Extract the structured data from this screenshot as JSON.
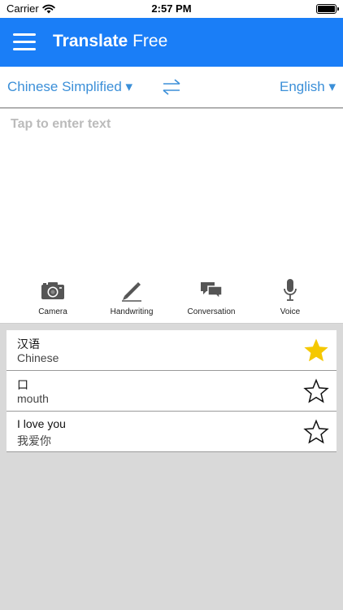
{
  "status_bar": {
    "carrier": "Carrier",
    "time": "2:57 PM",
    "battery_level": 1.0
  },
  "nav": {
    "title_bold": "Translate",
    "title_light": "Free",
    "menu_icon": "hamburger-menu-icon",
    "background_color": "#1a7ef7"
  },
  "languages": {
    "source": "Chinese Simplified ▾",
    "target": "English ▾",
    "swap_icon": "swap-arrows-icon",
    "accent_color": "#3b8fd8"
  },
  "input": {
    "placeholder": "Tap to enter text",
    "value": ""
  },
  "tools": [
    {
      "label": "Camera",
      "icon": "camera-icon"
    },
    {
      "label": "Handwriting",
      "icon": "pencil-icon"
    },
    {
      "label": "Conversation",
      "icon": "chat-bubbles-icon"
    },
    {
      "label": "Voice",
      "icon": "microphone-icon"
    }
  ],
  "history": [
    {
      "source": "汉语",
      "translation": "Chinese",
      "favorited": true
    },
    {
      "source": "口",
      "translation": "mouth",
      "favorited": false
    },
    {
      "source": "I love you",
      "translation": "我爱你",
      "favorited": false
    }
  ],
  "star_color": "#f5c800"
}
